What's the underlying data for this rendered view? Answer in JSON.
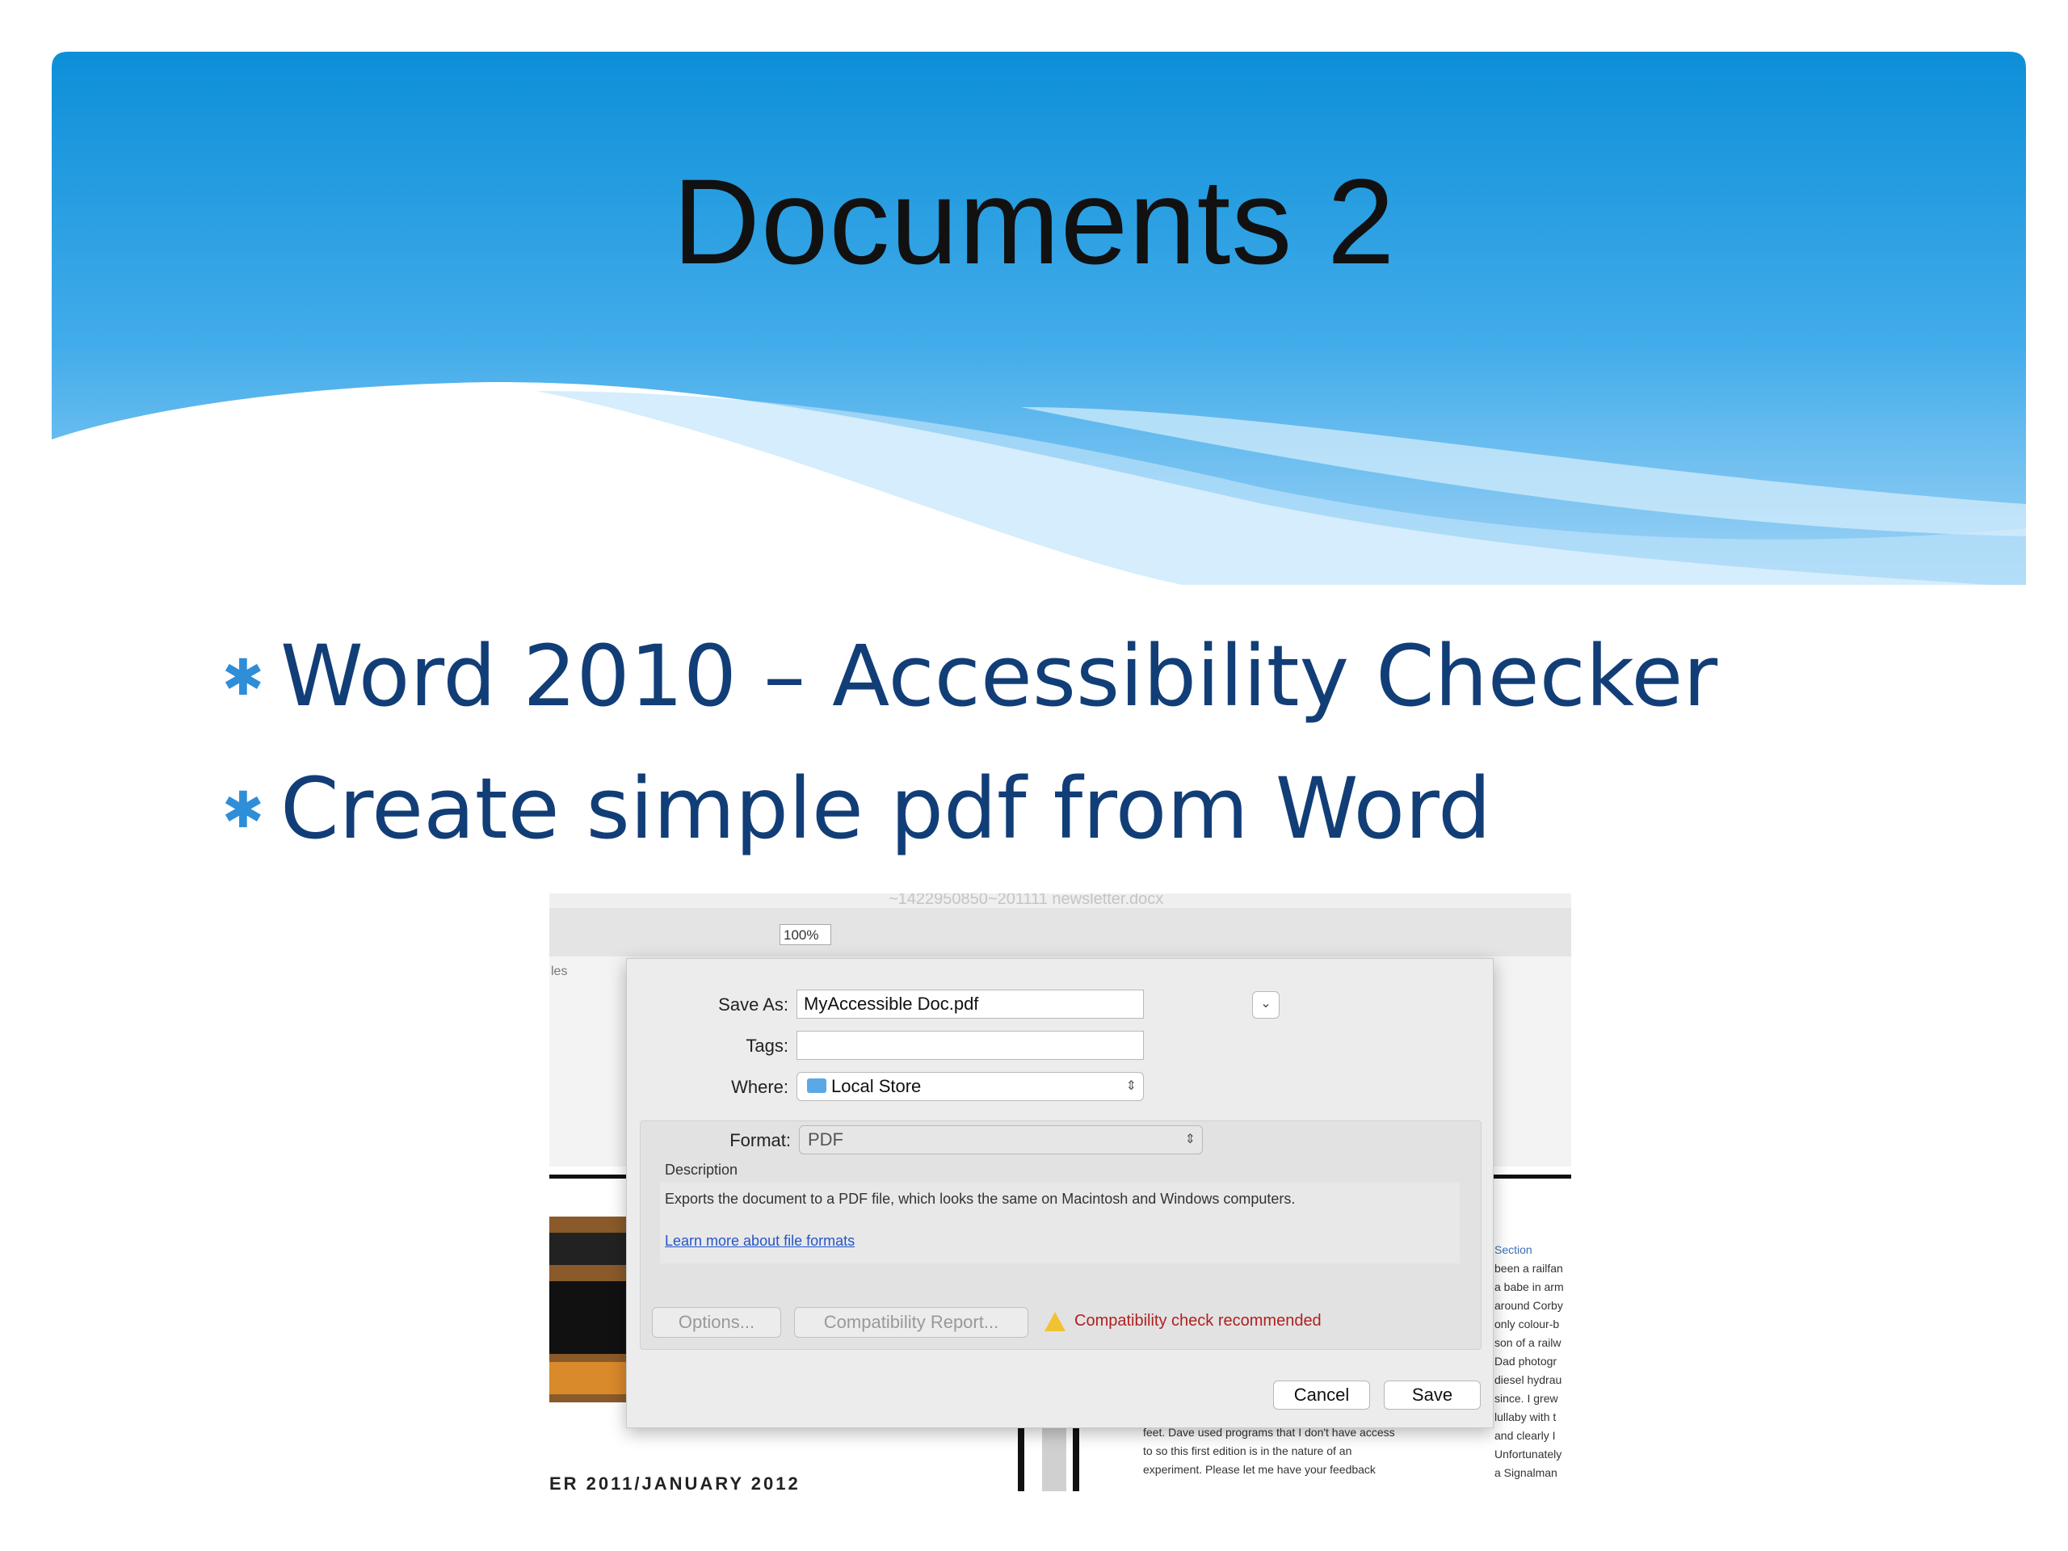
{
  "slide": {
    "title": "Documents 2",
    "bullets": [
      "Word 2010 – Accessibility Checker",
      "Create simple pdf from Word"
    ]
  },
  "colors": {
    "banner_top": "#0d8fd8",
    "banner_bottom": "#9fd3f6",
    "bullet_text": "#123e77",
    "bullet_star": "#2f8ed8"
  },
  "word_window": {
    "title": "~1422950850~201111 newsletter.docx",
    "zoom": "100%",
    "ribbon_tab": "les",
    "right_article": [
      "Section",
      "been a railfan",
      "a babe in arm",
      "around Corby",
      "only colour-b",
      "son of a railw",
      "Dad photogr",
      "diesel hydrau",
      "since. I grew",
      "lullaby with t",
      "and clearly I",
      "Unfortunately",
      "a Signalman"
    ],
    "bottom_article": [
      "feet. Dave used programs that I don't have access",
      "to so this first edition is in the nature of an",
      "experiment. Please let me have your feedback"
    ],
    "issue_date": "ER 2011/JANUARY 2012"
  },
  "dialog": {
    "save_as_label": "Save As:",
    "save_as_value": "MyAccessible Doc.pdf",
    "tags_label": "Tags:",
    "tags_value": "",
    "where_label": "Where:",
    "where_value": "Local Store",
    "format_label": "Format:",
    "format_value": "PDF",
    "description_label": "Description",
    "description_text": "Exports the document to a PDF file, which looks the same on Macintosh and Windows computers.",
    "learn_more": "Learn more about file formats",
    "options_button": "Options...",
    "compat_button": "Compatibility Report...",
    "compat_warning": "Compatibility check recommended",
    "cancel_button": "Cancel",
    "save_button": "Save"
  }
}
